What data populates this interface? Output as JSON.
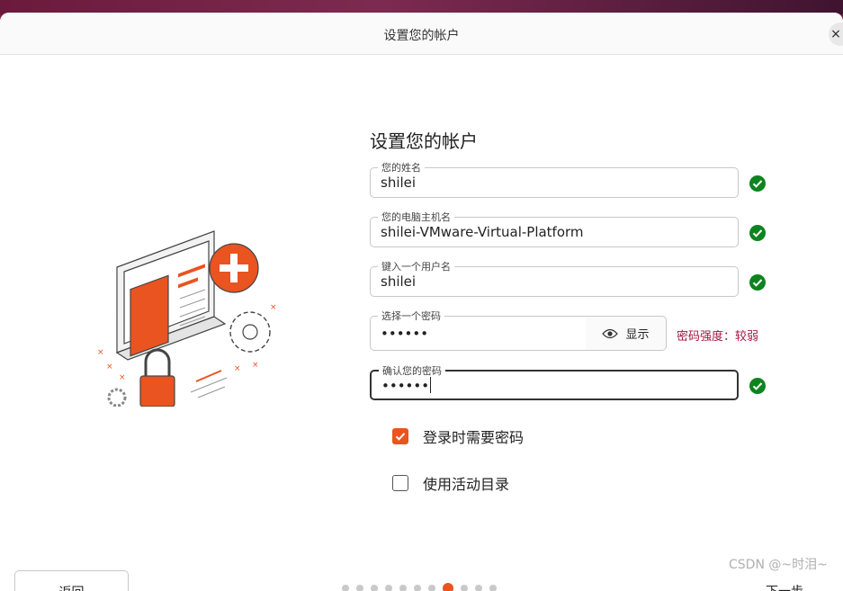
{
  "window": {
    "title": "设置您的帐户",
    "close_label": "×"
  },
  "form": {
    "heading": "设置您的帐户",
    "name": {
      "label": "您的姓名",
      "value": "shilei"
    },
    "hostname": {
      "label": "您的电脑主机名",
      "value": "shilei-VMware-Virtual-Platform"
    },
    "username": {
      "label": "键入一个用户名",
      "value": "shilei"
    },
    "password": {
      "label": "选择一个密码",
      "value": "••••••",
      "show_label": "显示",
      "strength": "密码强度：较弱"
    },
    "confirm": {
      "label": "确认您的密码",
      "value": "••••••"
    },
    "require_password": {
      "label": "登录时需要密码",
      "checked": true
    },
    "active_directory": {
      "label": "使用活动目录",
      "checked": false
    }
  },
  "nav": {
    "back_label": "返回",
    "next_label": "下一步",
    "steps_total": 11,
    "current_step": 8
  },
  "colors": {
    "accent": "#e95420",
    "ok": "#0e8420",
    "weak": "#a3163f"
  },
  "watermark": "CSDN @~时泪~"
}
